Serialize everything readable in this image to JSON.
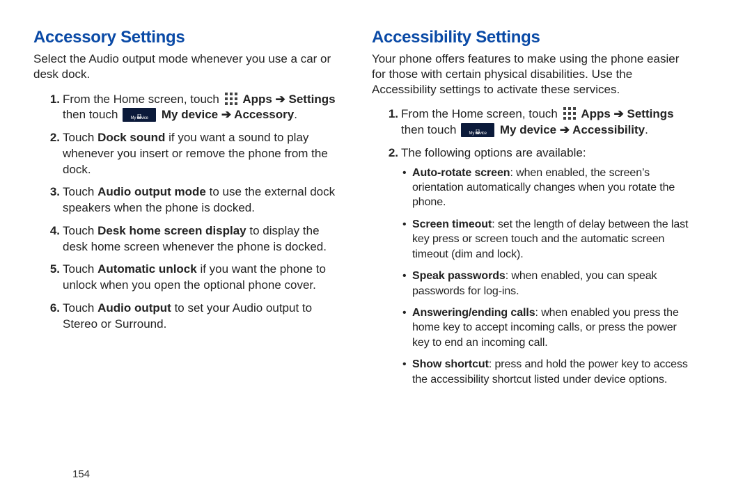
{
  "page_number": "154",
  "left": {
    "heading": "Accessory Settings",
    "intro": "Select the Audio output mode whenever you use a car or desk dock.",
    "step1": {
      "num": "1.",
      "prefix": "From the Home screen, touch ",
      "apps_arrow_settings": "Apps ➔ Settings",
      "then_touch": "then touch ",
      "mydevice_arrow": "My device ➔ Accessory",
      "period": "."
    },
    "step2": {
      "num": "2.",
      "pre": "Touch ",
      "bold": "Dock sound",
      "post": " if you want a sound to play whenever you insert or remove the phone from the dock."
    },
    "step3": {
      "num": "3.",
      "pre": "Touch ",
      "bold": "Audio output mode",
      "post": " to use the external dock speakers when the phone is docked."
    },
    "step4": {
      "num": "4.",
      "pre": "Touch ",
      "bold": "Desk home screen display",
      "post": " to display the desk home screen whenever the phone is docked."
    },
    "step5": {
      "num": "5.",
      "pre": "Touch ",
      "bold": "Automatic unlock",
      "post": " if you want the phone to unlock when you open the optional phone cover."
    },
    "step6": {
      "num": "6.",
      "pre": "Touch ",
      "bold": "Audio output",
      "post": " to set your Audio output to Stereo or Surround."
    }
  },
  "right": {
    "heading": "Accessibility Settings",
    "intro": "Your phone offers features to make using the phone easier for those with certain physical disabilities. Use the Accessibility settings to activate these services.",
    "step1": {
      "num": "1.",
      "prefix": "From the Home screen, touch ",
      "apps_arrow_settings": "Apps ➔ Settings",
      "then_touch": "then touch ",
      "mydevice_arrow": "My device ➔ Accessibility",
      "period": "."
    },
    "step2": {
      "num": "2.",
      "text": "The following options are available:"
    },
    "bullets": {
      "b1": {
        "bold": "Auto-rotate screen",
        "post": ": when enabled, the screen’s orientation automatically changes when you rotate the phone."
      },
      "b2": {
        "bold": "Screen timeout",
        "post": ": set the length of delay between the last key press or screen touch and the automatic screen timeout (dim and lock)."
      },
      "b3": {
        "bold": "Speak passwords",
        "post": ": when enabled, you can speak passwords for log-ins."
      },
      "b4": {
        "bold": "Answering/ending calls",
        "post": ": when enabled you press the home key to accept incoming calls, or press the power key to end an incoming call."
      },
      "b5": {
        "bold": "Show shortcut",
        "post": ": press and hold the power key to access the accessibility shortcut listed under device options."
      }
    }
  },
  "icons": {
    "mydevice_label": "My device"
  }
}
